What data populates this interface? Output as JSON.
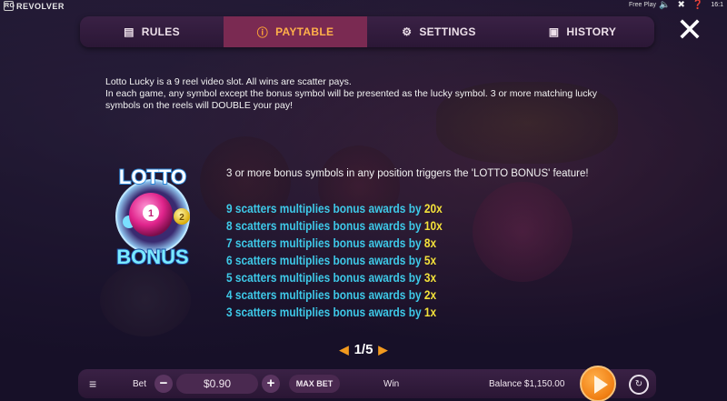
{
  "topbar": {
    "brand": "REVOLVER",
    "brand_badge": "RG",
    "free_play": "Free Play",
    "icons": [
      "sound-icon",
      "close-icon",
      "help-icon"
    ],
    "time": "16:1"
  },
  "tabs": [
    {
      "label": "RULES",
      "icon": "document-icon",
      "glyph": "▤",
      "active": false
    },
    {
      "label": "PAYTABLE",
      "icon": "info-icon",
      "glyph": "ⓘ",
      "active": true
    },
    {
      "label": "SETTINGS",
      "icon": "gear-icon",
      "glyph": "⚙",
      "active": false
    },
    {
      "label": "HISTORY",
      "icon": "calendar-icon",
      "glyph": "▣",
      "active": false
    }
  ],
  "close_glyph": "✕",
  "intro": {
    "line1": "Lotto Lucky is a 9 reel video slot. All wins are scatter pays.",
    "line2": " In each game, any symbol except the bonus symbol will be presented as the lucky symbol. 3 or more matching lucky symbols on the reels will DOUBLE your pay!"
  },
  "logo": {
    "word_top": "LOTTO",
    "word_bottom": "BONUS",
    "ball_number": "1",
    "small_ball": "2"
  },
  "bonus": {
    "trigger_text": "3 or more bonus symbols in any position triggers the 'LOTTO BONUS' feature!",
    "awards": [
      {
        "text": "9 scatters multiplies bonus awards by ",
        "mult": "20x"
      },
      {
        "text": "8 scatters multiplies bonus awards by ",
        "mult": "10x"
      },
      {
        "text": "7 scatters multiplies bonus awards by ",
        "mult": "8x"
      },
      {
        "text": "6 scatters multiplies bonus awards by ",
        "mult": "5x"
      },
      {
        "text": "5 scatters multiplies bonus awards by ",
        "mult": "3x"
      },
      {
        "text": "4 scatters multiplies bonus awards by ",
        "mult": "2x"
      },
      {
        "text": "3 scatters multiplies bonus awards by ",
        "mult": "1x"
      }
    ]
  },
  "pager": {
    "label": "1/5",
    "prev": "◀",
    "next": "▶"
  },
  "bottom": {
    "menu_glyph": "≡",
    "bet_label": "Bet",
    "minus": "−",
    "bet_value": "$0.90",
    "plus": "+",
    "max_bet": "MAX BET",
    "win_label": "Win",
    "balance": "Balance $1,150.00",
    "auto_glyph": "↻"
  },
  "colors": {
    "accent_orange": "#ffa635",
    "award_cyan": "#3ec9e8",
    "award_yellow": "#f4e23a",
    "tab_active_bg": "#7a2a52"
  }
}
